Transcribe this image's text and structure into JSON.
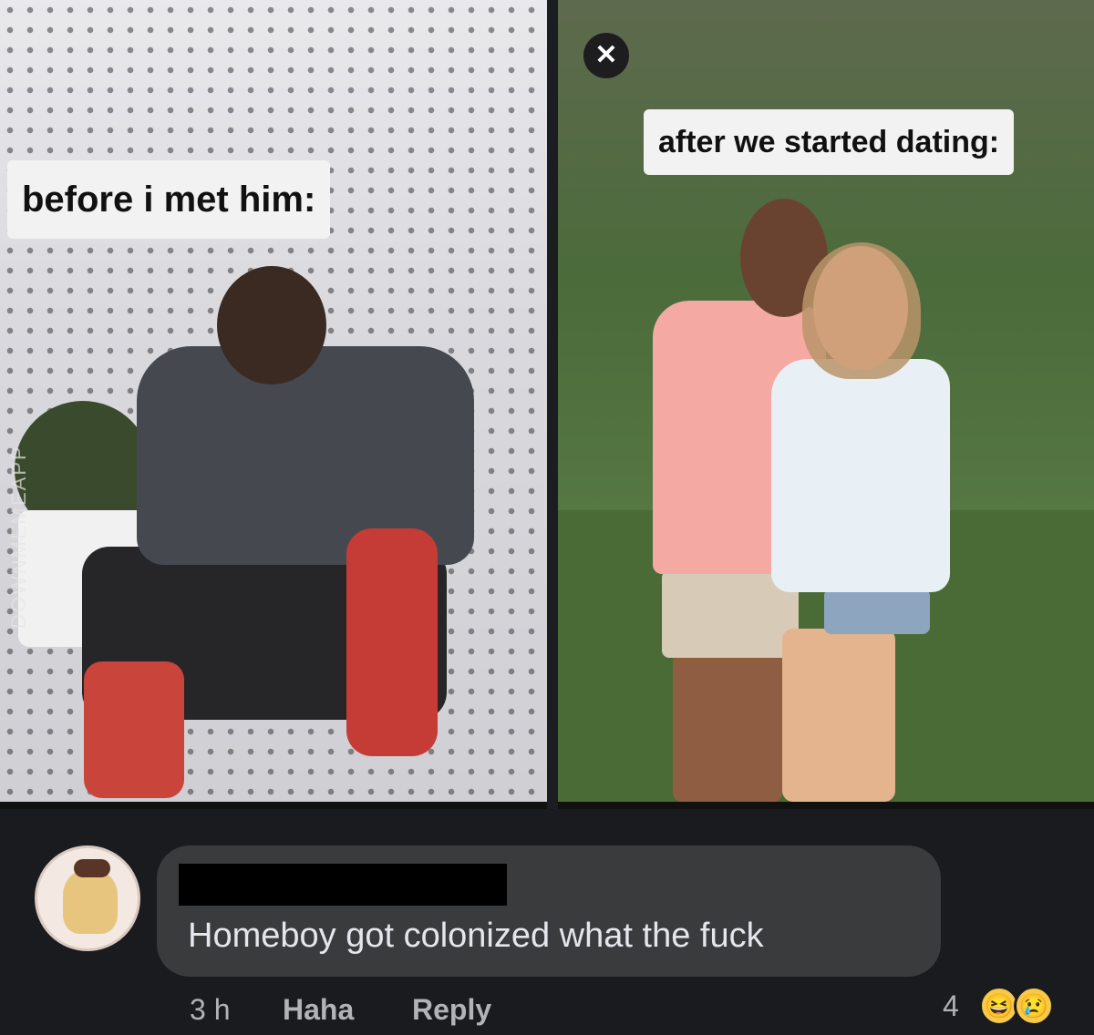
{
  "left_panel": {
    "caption": "before i met him:",
    "watermark": "DOWNMEMEAPP"
  },
  "right_panel": {
    "caption": "after we started dating:",
    "close_glyph": "✕"
  },
  "comment": {
    "text": "Homeboy got colonized what the fuck",
    "author_redacted": true
  },
  "actions": {
    "time": "3 h",
    "haha": "Haha",
    "reply": "Reply"
  },
  "reactions": {
    "count": "4",
    "icons": [
      "haha-emoji-icon",
      "sad-emoji-icon"
    ],
    "emoji_1": "😆",
    "emoji_2": "😢"
  },
  "colors": {
    "background": "#1a1b1e",
    "bubble": "#3a3b3d",
    "text": "#e4e6eb",
    "muted": "#b0b3b8"
  }
}
